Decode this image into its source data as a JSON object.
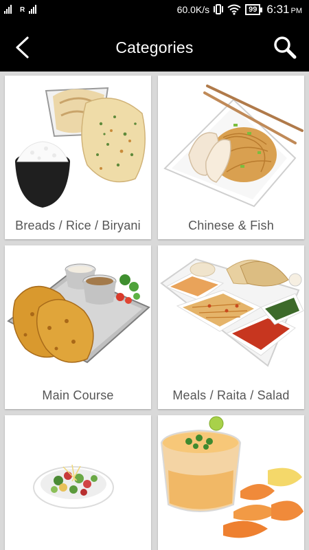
{
  "status_bar": {
    "signal1_label": "",
    "signal2_label": "R",
    "net_speed": "60.0K/s",
    "battery": "99",
    "time": "6:31",
    "ampm": "PM"
  },
  "toolbar": {
    "title": "Categories",
    "back_icon": "chevron-left-icon",
    "search_icon": "search-icon"
  },
  "categories": [
    {
      "label": "Breads / Rice / Biryani",
      "image": "breads-rice-image"
    },
    {
      "label": "Chinese & Fish",
      "image": "chinese-fish-image"
    },
    {
      "label": "Main Course",
      "image": "main-course-image"
    },
    {
      "label": "Meals / Raita / Salad",
      "image": "meals-raita-salad-image"
    },
    {
      "label": "",
      "image": "salad-bowl-image"
    },
    {
      "label": "",
      "image": "soup-dessert-image"
    }
  ],
  "colors": {
    "toolbar_bg": "#000000",
    "page_bg": "#d9d9d9",
    "card_bg": "#ffffff",
    "label_text": "#555555"
  }
}
